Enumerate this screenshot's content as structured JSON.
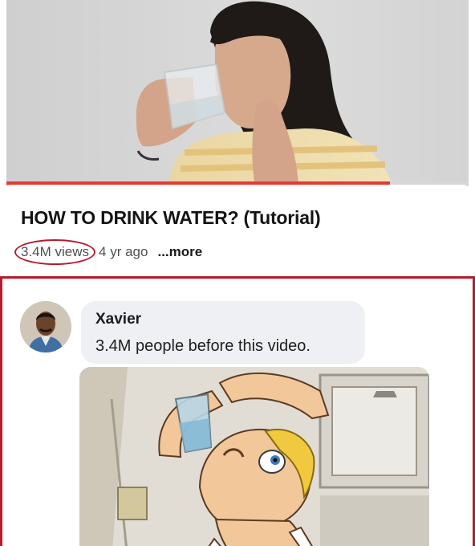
{
  "video": {
    "title": "HOW TO DRINK WATER? (Tutorial)",
    "views": "3.4M views",
    "age": "4 yr ago",
    "more_label": "...more",
    "progress_fraction": 0.83,
    "highlight_color": "#b71c2c"
  },
  "comment": {
    "author": "Xavier",
    "text": "3.4M people before this video.",
    "avatar_icon": "user-avatar-photo",
    "image_icon": "cartoon-drinking-water-image"
  }
}
